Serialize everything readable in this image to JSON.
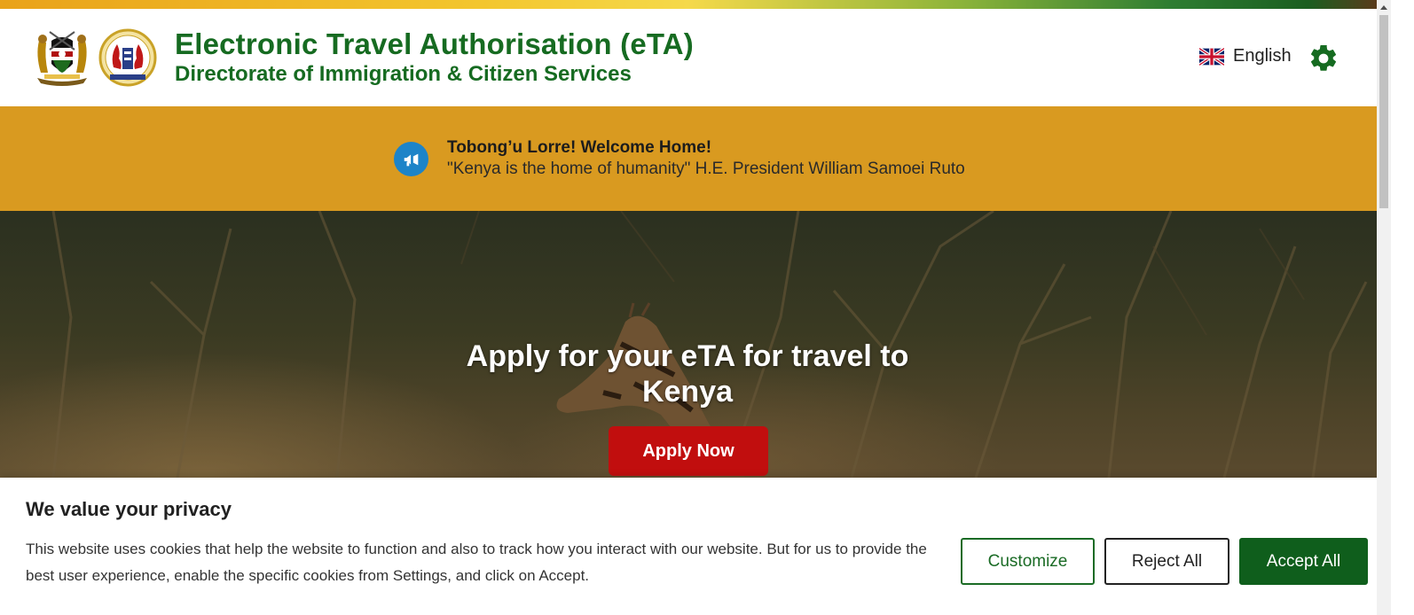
{
  "header": {
    "title": "Electronic Travel Authorisation (eTA)",
    "subtitle": "Directorate of Immigration & Citizen Services",
    "logos": [
      "kenya-coat-of-arms-logo",
      "immigration-seal-logo"
    ],
    "language": {
      "label": "English",
      "icon": "uk-flag-icon"
    },
    "settings_icon": "gear-icon"
  },
  "announcement": {
    "icon": "megaphone-icon",
    "title": "Tobong’u Lorre! Welcome Home!",
    "quote": "\"Kenya is the home of humanity\" H.E. President William Samoei Ruto"
  },
  "hero": {
    "title": "Apply for your eTA for travel to Kenya",
    "apply_label": "Apply Now"
  },
  "cookie_banner": {
    "title": "We value your privacy",
    "text": "This website uses cookies that help the website to function and also to track how you interact with our website. But for us to provide the best user experience, enable the specific cookies from Settings, and click on Accept.",
    "customize_label": "Customize",
    "reject_label": "Reject All",
    "accept_label": "Accept All"
  },
  "colors": {
    "brand_green": "#166b21",
    "banner_gold": "#d99a20",
    "apply_red": "#c10e0e",
    "accept_green": "#0f5e1c",
    "megaphone_blue": "#1d84c8"
  }
}
